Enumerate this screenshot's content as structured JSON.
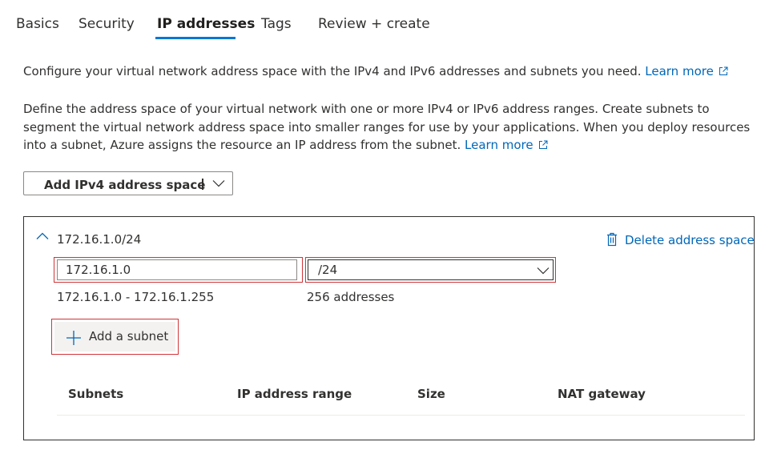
{
  "tabs": [
    {
      "label": "Basics",
      "active": false
    },
    {
      "label": "Security",
      "active": false
    },
    {
      "label": "IP addresses",
      "active": true
    },
    {
      "label": "Tags",
      "active": false
    },
    {
      "label": "Review + create",
      "active": false
    }
  ],
  "intro": {
    "text": "Configure your virtual network address space with the IPv4 and IPv6 addresses and subnets you need.",
    "learn_more": "Learn more"
  },
  "description": {
    "text": "Define the address space of your virtual network with one or more IPv4 or IPv6 address ranges. Create subnets to segment the virtual network address space into smaller ranges for use by your applications. When you deploy resources into a subnet, Azure assigns the resource an IP address from the subnet.",
    "learn_more": "Learn more"
  },
  "add_space_button": {
    "label": "Add IPv4 address space"
  },
  "address_space": {
    "title": "172.16.1.0/24",
    "delete_label": "Delete address space",
    "address_value": "172.16.1.0",
    "prefix_value": "/24",
    "range": "172.16.1.0 - 172.16.1.255",
    "count": "256 addresses",
    "add_subnet_label": "Add a subnet",
    "table_headers": [
      "Subnets",
      "IP address range",
      "Size",
      "NAT gateway"
    ]
  },
  "colors": {
    "accent": "#0078d4",
    "link": "#0067b8",
    "error_outline": "#d13438",
    "text": "#323130"
  },
  "icons": {
    "external_link": "external-link-icon",
    "chevron_down": "chevron-down-icon",
    "chevron_up": "chevron-up-icon",
    "trash": "trash-icon",
    "add": "plus-icon"
  }
}
